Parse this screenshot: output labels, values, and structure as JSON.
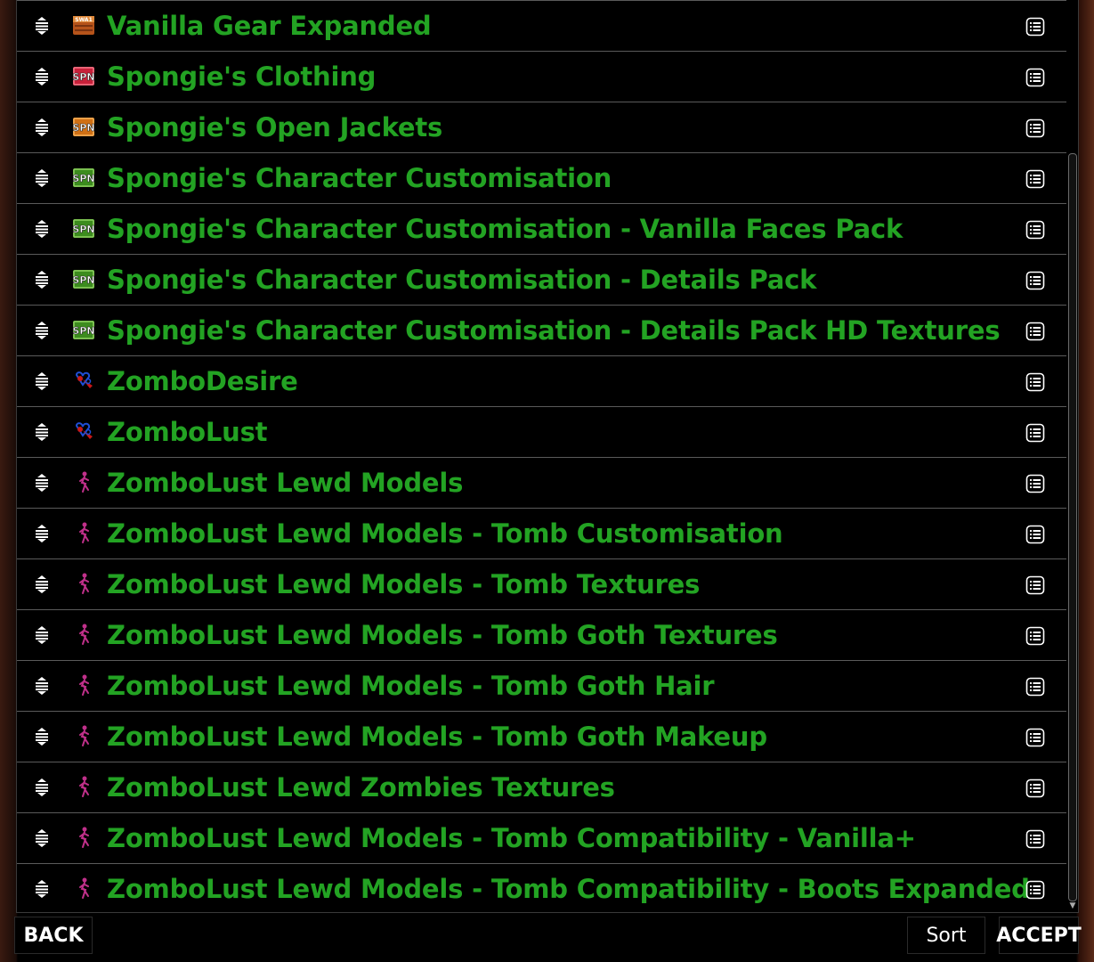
{
  "mods": [
    {
      "name": "Vanilla Gear Expanded",
      "icon": "swa-badge-icon"
    },
    {
      "name": "Spongie's Clothing",
      "icon": "spn-red-icon"
    },
    {
      "name": "Spongie's Open Jackets",
      "icon": "spn-orange-icon"
    },
    {
      "name": "Spongie's Character Customisation",
      "icon": "spn-green-icon"
    },
    {
      "name": "Spongie's Character Customisation - Vanilla Faces Pack",
      "icon": "spn-green-icon"
    },
    {
      "name": "Spongie's Character Customisation - Details Pack",
      "icon": "spn-green-icon"
    },
    {
      "name": "Spongie's Character Customisation - Details Pack HD Textures",
      "icon": "spn-green-icon"
    },
    {
      "name": "ZomboDesire",
      "icon": "zombo-heart-icon"
    },
    {
      "name": "ZomboLust",
      "icon": "zombo-heart-icon"
    },
    {
      "name": "ZomboLust Lewd Models",
      "icon": "pink-figure-icon"
    },
    {
      "name": "ZomboLust Lewd Models - Tomb Customisation",
      "icon": "pink-figure-icon"
    },
    {
      "name": "ZomboLust Lewd Models - Tomb Textures",
      "icon": "pink-figure-icon"
    },
    {
      "name": "ZomboLust Lewd Models - Tomb Goth Textures",
      "icon": "pink-figure-icon"
    },
    {
      "name": "ZomboLust Lewd Models - Tomb Goth Hair",
      "icon": "pink-figure-icon"
    },
    {
      "name": "ZomboLust Lewd Models - Tomb Goth Makeup",
      "icon": "pink-figure-icon"
    },
    {
      "name": "ZomboLust Lewd Zombies Textures",
      "icon": "pink-figure-icon"
    },
    {
      "name": "ZomboLust Lewd Models - Tomb Compatibility - Vanilla+",
      "icon": "pink-figure-icon"
    },
    {
      "name": "ZomboLust Lewd Models - Tomb Compatibility - Boots Expanded",
      "icon": "pink-figure-icon"
    }
  ],
  "icon_text": {
    "swa": "SWA1",
    "spn": "SPN"
  },
  "buttons": {
    "back": "BACK",
    "sort": "Sort",
    "accept": "ACCEPT"
  },
  "colors": {
    "mod_name": "#23a323",
    "row_border": "#5a5a5a"
  }
}
